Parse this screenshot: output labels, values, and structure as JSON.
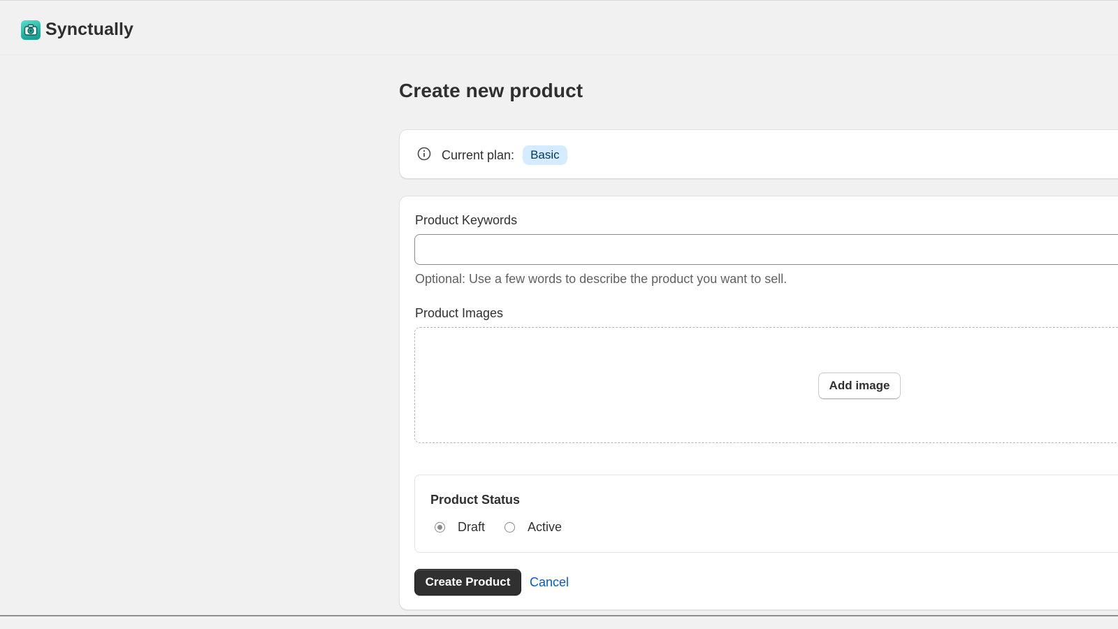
{
  "app": {
    "name": "Synctually",
    "logo_icon": "camera-icon"
  },
  "page": {
    "title": "Create new product"
  },
  "plan": {
    "icon": "info-icon",
    "label": "Current plan:",
    "badge": "Basic",
    "badge_color": "#d5ebff"
  },
  "form": {
    "keywords_label": "Product Keywords",
    "keywords_value": "",
    "keywords_placeholder": "",
    "keywords_help": "Optional: Use a few words to describe the product you want to sell.",
    "images_label": "Product Images",
    "add_image_label": "Add image",
    "status_title": "Product Status",
    "status_options": [
      {
        "label": "Draft",
        "selected": true
      },
      {
        "label": "Active",
        "selected": false
      }
    ],
    "submit_label": "Create Product",
    "cancel_label": "Cancel"
  },
  "colors": {
    "background": "#f1f1f1",
    "primary_button": "#303030",
    "link": "#005bd3",
    "logo_accent": "#1fb3a5"
  }
}
